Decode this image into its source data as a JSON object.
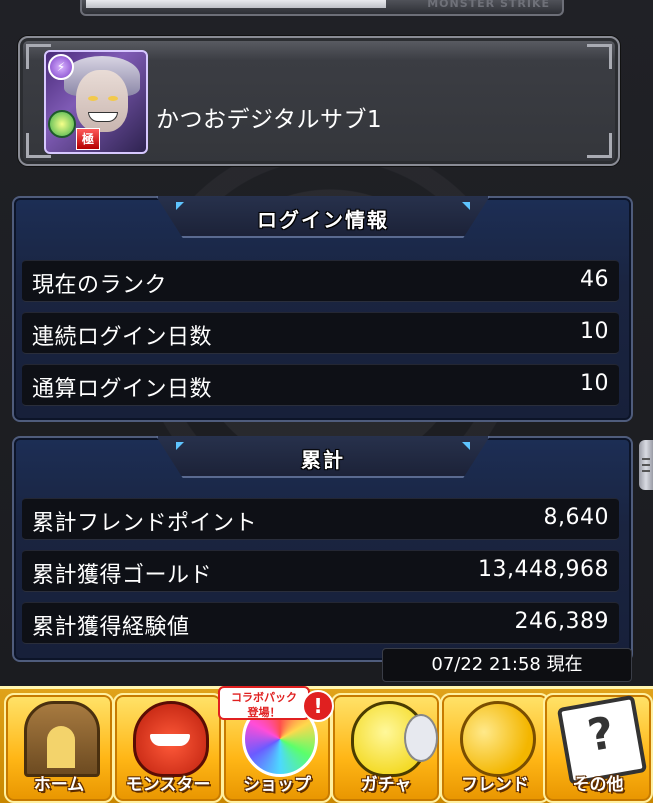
{
  "top_logo": "MONSTER STRIKE",
  "profile": {
    "name": "かつおデジタルサブ1",
    "avatar_rank_label": "極"
  },
  "login_info": {
    "title": "ログイン情報",
    "rows": [
      {
        "label": "現在のランク",
        "value": "46"
      },
      {
        "label": "連続ログイン日数",
        "value": "10"
      },
      {
        "label": "通算ログイン日数",
        "value": "10"
      }
    ]
  },
  "totals": {
    "title": "累計",
    "rows": [
      {
        "label": "累計フレンドポイント",
        "value": "8,640"
      },
      {
        "label": "累計獲得ゴールド",
        "value": "13,448,968"
      },
      {
        "label": "累計獲得経験値",
        "value": "246,389"
      }
    ]
  },
  "timestamp": "07/22 21:58 現在",
  "shop_badge": "コラボパック\n登場！",
  "shop_alert": "!",
  "nav": [
    {
      "label": "ホーム",
      "icon": "home-gate-icon"
    },
    {
      "label": "モンスター",
      "icon": "monster-icon"
    },
    {
      "label": "ショップ",
      "icon": "rainbow-orb-icon"
    },
    {
      "label": "ガチャ",
      "icon": "egg-icon"
    },
    {
      "label": "フレンド",
      "icon": "friend-balloon-icon"
    },
    {
      "label": "その他",
      "icon": "question-card-icon"
    }
  ],
  "colors": {
    "panel_bg": "#1a2440",
    "row_bg": "#0e1016",
    "nav_bg": "#e0a21a",
    "accent_blue": "#5ec4ff"
  }
}
